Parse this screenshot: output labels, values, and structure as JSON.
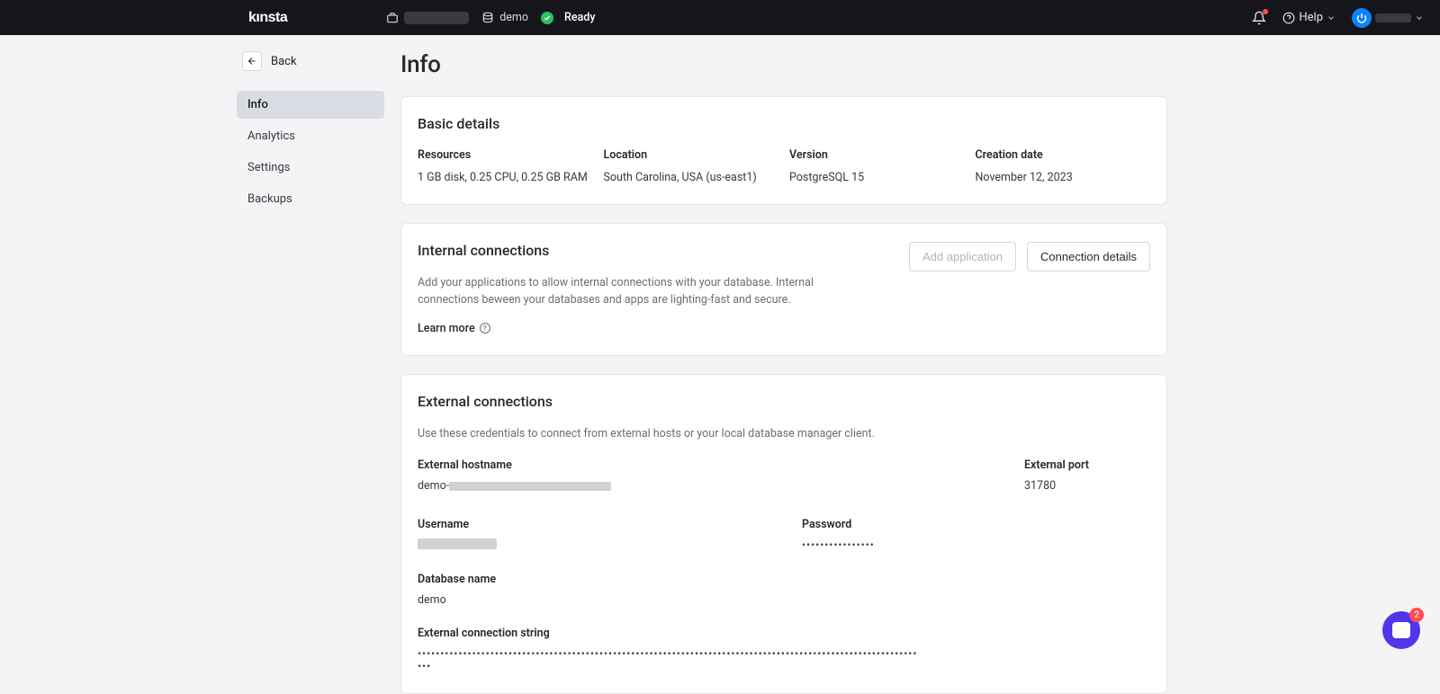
{
  "brand": "kınsta",
  "crumbs": {
    "db_name": "demo",
    "status": "Ready"
  },
  "help_label": "Help",
  "back_label": "Back",
  "sidebar": {
    "items": [
      {
        "label": "Info"
      },
      {
        "label": "Analytics"
      },
      {
        "label": "Settings"
      },
      {
        "label": "Backups"
      }
    ]
  },
  "page_title": "Info",
  "basic": {
    "title": "Basic details",
    "cols": [
      {
        "label": "Resources",
        "value": "1 GB disk, 0.25 CPU, 0.25 GB RAM"
      },
      {
        "label": "Location",
        "value": "South Carolina, USA (us-east1)"
      },
      {
        "label": "Version",
        "value": "PostgreSQL 15"
      },
      {
        "label": "Creation date",
        "value": "November 12, 2023"
      }
    ]
  },
  "internal": {
    "title": "Internal connections",
    "desc": "Add your applications to allow internal connections with your database. Internal connections beween your databases and apps are lighting-fast and secure.",
    "learn_more": "Learn more",
    "add_btn": "Add application",
    "details_btn": "Connection details"
  },
  "external": {
    "title": "External connections",
    "desc": "Use these credentials to connect from external hosts or your local database manager client.",
    "host_label": "External hostname",
    "host_prefix": "demo-",
    "port_label": "External port",
    "port_value": "31780",
    "user_label": "Username",
    "pass_label": "Password",
    "pass_value": "••••••••••••••••",
    "dbname_label": "Database name",
    "dbname_value": "demo",
    "connstr_label": "External connection string",
    "connstr_value": "•••••••••••••••••••••••••••••••••••••••••••••••••••••••••••••••••••••••••••••••••••••••••••••••••••••••••••••••••"
  },
  "chat_badge": "2"
}
